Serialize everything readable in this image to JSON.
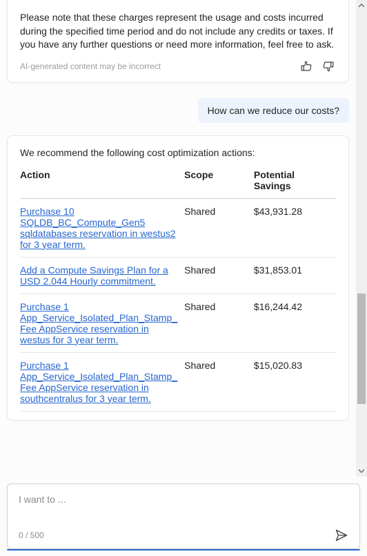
{
  "ai_previous": {
    "note": "Please note that these charges represent the usage and costs incurred during the specified time period and do not include any credits or taxes. If you have any further questions or need more information, feel free to ask.",
    "disclaimer": "AI-generated content may be incorrect"
  },
  "user_message": "How can we reduce our costs?",
  "recommendations": {
    "intro": "We recommend the following cost optimization actions:",
    "headers": {
      "action": "Action",
      "scope": "Scope",
      "savings": "Potential Savings"
    },
    "rows": [
      {
        "action": "Purchase 10 SQLDB_BC_Compute_Gen5 sqldatabases reservation in westus2 for 3 year term.",
        "scope": "Shared",
        "savings": "$43,931.28"
      },
      {
        "action": "Add a Compute Savings Plan for a USD 2.044 Hourly commitment.",
        "scope": "Shared",
        "savings": "$31,853.01"
      },
      {
        "action": "Purchase 1 App_Service_Isolated_Plan_Stamp_Fee AppService reservation in westus for 3 year term.",
        "scope": "Shared",
        "savings": "$16,244.42"
      },
      {
        "action": "Purchase 1 App_Service_Isolated_Plan_Stamp_Fee AppService reservation in southcentralus for 3 year term.",
        "scope": "Shared",
        "savings": "$15,020.83"
      }
    ]
  },
  "input": {
    "placeholder": "I want to ...",
    "counter": "0 / 500"
  }
}
